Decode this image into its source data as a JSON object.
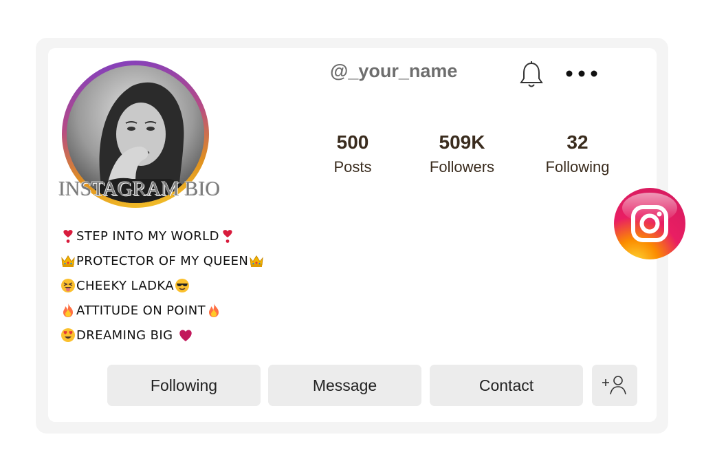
{
  "profile": {
    "username": "@_your_name",
    "watermark": "INSTAGRAM BIO"
  },
  "stats": [
    {
      "value": "500",
      "label": "Posts"
    },
    {
      "value": "509K",
      "label": "Followers"
    },
    {
      "value": "32",
      "label": "Following"
    }
  ],
  "bio": [
    {
      "lead": "heart-exclamation",
      "text": "STEP INTO MY WORLD",
      "trail": "heart-exclamation"
    },
    {
      "lead": "crown",
      "text": "PROTECTOR OF MY QUEEN",
      "trail": "crown"
    },
    {
      "lead": "squinting-tongue-face",
      "text": "CHEEKY LADKA",
      "trail": "sunglasses-face"
    },
    {
      "lead": "fire",
      "text": "ATTITUDE ON POINT",
      "trail": "fire"
    },
    {
      "lead": "heart-eyes-face",
      "text": "DREAMING BIG ",
      "trail": "red-heart"
    }
  ],
  "buttons": {
    "following": "Following",
    "message": "Message",
    "contact": "Contact"
  },
  "icons": {
    "header": [
      "bell-icon",
      "more-options-icon"
    ],
    "add_user": "add-user-icon",
    "brand": "instagram-logo"
  },
  "colors": {
    "ring_start": "#7c3fc4",
    "ring_end": "#f6c92a",
    "button_bg": "#ececec",
    "stat_text": "#3a2c1e"
  }
}
